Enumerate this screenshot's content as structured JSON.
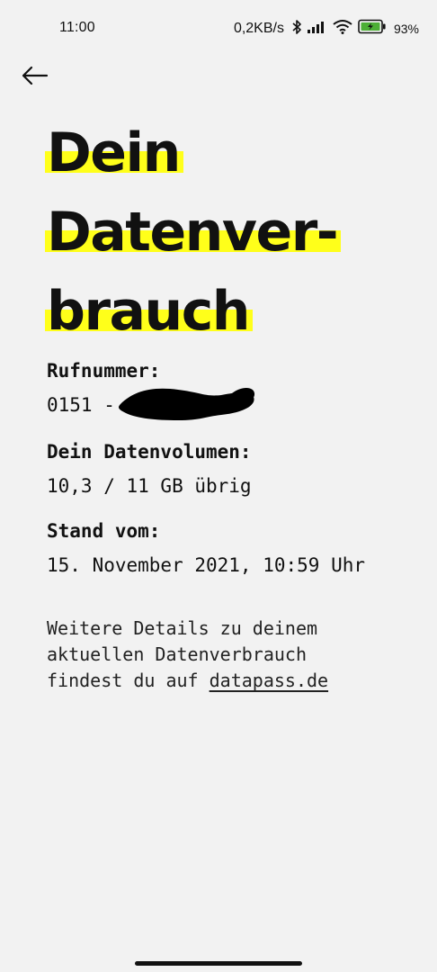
{
  "status_bar": {
    "time": "11:00",
    "net_speed": "0,2KB/s",
    "battery_percent": "93%",
    "icons": [
      "bluetooth-icon",
      "signal-icon",
      "wifi-icon",
      "battery-charging-icon"
    ]
  },
  "header": {
    "back_icon": "arrow-left-icon"
  },
  "title": {
    "line1": "Dein",
    "line2": "Datenver-",
    "line3": "brauch",
    "highlight_color": "#ffff1a"
  },
  "info": {
    "phone_label": "Rufnummer:",
    "phone_value": "0151 -",
    "volume_label": "Dein Datenvolumen:",
    "volume_value": "10,3 / 11 GB übrig",
    "date_label": "Stand vom:",
    "date_value": "15. November 2021, 10:59 Uhr"
  },
  "details": {
    "line1": "Weitere Details zu deinem",
    "line2": "aktuellen Datenverbrauch",
    "line3_prefix": "findest du auf ",
    "link_text": "datapass.de"
  }
}
